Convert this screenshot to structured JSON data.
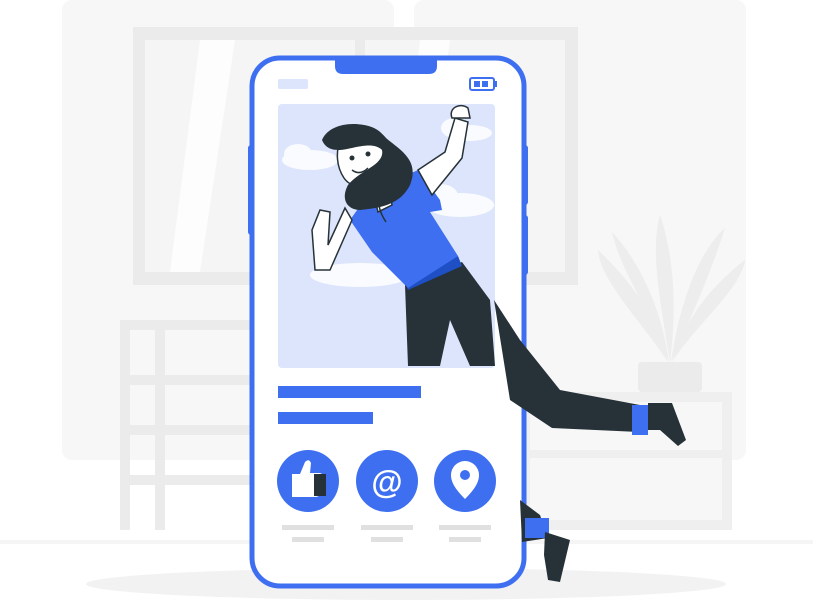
{
  "illustration": {
    "subject": "woman-jumping-out-of-phone",
    "colors": {
      "primary": "#3E6FF0",
      "primary_light": "#DCE5FB",
      "phone_border": "#3E6FF0",
      "phone_screen": "#ffffff",
      "skin": "#FFFFFF",
      "hair": "#263238",
      "shirt": "#3E6FF0",
      "pants": "#263238",
      "background_gray": "#F2F2F2",
      "background_mid": "#E6E6E6",
      "accent_bar": "#3E6FF0",
      "placeholder_gray": "#E0E0E0"
    }
  },
  "phone": {
    "status_icons": [
      "signal-bar",
      "battery-icon"
    ],
    "actions": [
      {
        "name": "like",
        "icon": "thumbs-up-icon"
      },
      {
        "name": "mention",
        "icon": "at-sign-icon"
      },
      {
        "name": "location",
        "icon": "location-pin-icon"
      }
    ]
  }
}
